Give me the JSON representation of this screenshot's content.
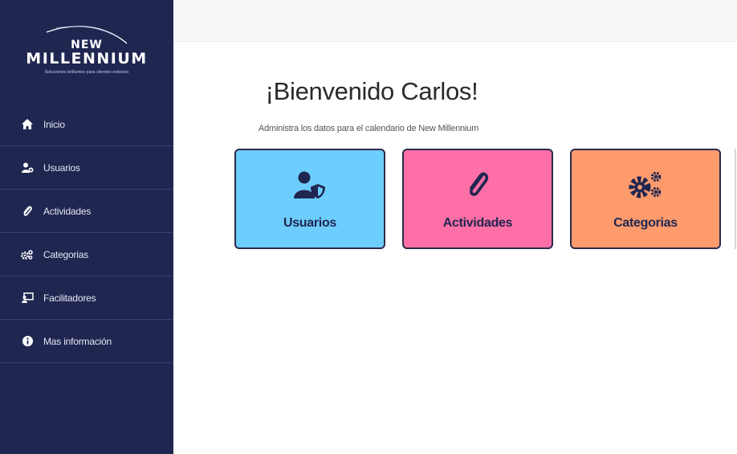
{
  "brand": {
    "line1": "NEW",
    "line2": "MILLENNIUM",
    "tagline": "Soluciones brillantes para clientes exitosos"
  },
  "sidebar": {
    "items": [
      {
        "label": "Inicio",
        "icon": "home-icon"
      },
      {
        "label": "Usuarios",
        "icon": "users-icon"
      },
      {
        "label": "Actividades",
        "icon": "paperclip-icon"
      },
      {
        "label": "Categorias",
        "icon": "gears-icon"
      },
      {
        "label": "Facilitadores",
        "icon": "chalkboard-teacher-icon"
      },
      {
        "label": "Mas información",
        "icon": "info-circle-icon"
      }
    ]
  },
  "main": {
    "title": "¡Bienvenido Carlos!",
    "subtitle": "Administra los datos para el calendario de New Millennium",
    "cards": [
      {
        "label": "Usuarios",
        "icon": "user-shield-icon",
        "color": "#6dcdfd"
      },
      {
        "label": "Actividades",
        "icon": "paperclip-icon",
        "color": "#fd6fa6"
      },
      {
        "label": "Categorias",
        "icon": "gears-icon",
        "color": "#fd9b6d"
      }
    ]
  },
  "colors": {
    "sidebar_bg": "#1f2650",
    "card_text": "#1f2650",
    "topbar_bg": "#f7f7f7"
  }
}
